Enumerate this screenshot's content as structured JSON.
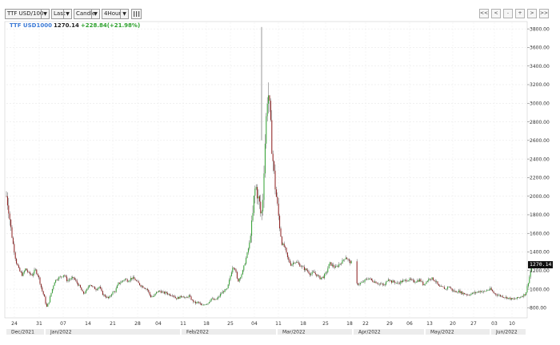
{
  "toolbar": {
    "symbol": "TTF USD/100",
    "price_type": "Last",
    "chart_style": "Candle",
    "interval": "4Hour",
    "dropdown_arrow": "▼",
    "indicators_icon": "bars-icon",
    "nav": [
      "<<",
      "<",
      "-",
      "+",
      ">",
      ">>"
    ]
  },
  "legend": {
    "symbol": "TTF USD1000",
    "last": "1270.14",
    "change": "+228.84(+21.98%)"
  },
  "last_price_tag": "1270.14",
  "colors": {
    "up": "#2ca02c",
    "down": "#8b1a1a",
    "legend_symbol": "#3d7bd6",
    "change": "#2ca02c"
  },
  "chart_data": {
    "type": "candlestick",
    "y_ticks": [
      800,
      1000,
      1200,
      1400,
      1600,
      1800,
      2000,
      2200,
      2400,
      2600,
      2800,
      3000,
      3200,
      3400,
      3600,
      3800
    ],
    "y_tick_labels": [
      "800.00",
      "1000.00",
      "1200.00",
      "1400.00",
      "1600.00",
      "1800.00",
      "2000.00",
      "2200.00",
      "2400.00",
      "2600.00",
      "2800.00",
      "3000.00",
      "3200.00",
      "3400.00",
      "3600.00",
      "3800.00"
    ],
    "ylim": [
      700,
      3870
    ],
    "x_ticks": [
      "24",
      "31",
      "07",
      "14",
      "21",
      "28",
      "04",
      "11",
      "18",
      "25",
      "04",
      "11",
      "18",
      "25",
      "18",
      "22",
      "29",
      "06",
      "13",
      "20",
      "27",
      "03",
      "10"
    ],
    "months": [
      "Dec/2021",
      "Jan/2022",
      "Feb/2022",
      "Mar/2022",
      "Apr/2022",
      "May/2022",
      "Jun/2022"
    ],
    "grid": true,
    "close_path": [
      [
        0,
        2000
      ],
      [
        3,
        1850
      ],
      [
        6,
        1620
      ],
      [
        9,
        1450
      ],
      [
        12,
        1300
      ],
      [
        16,
        1200
      ],
      [
        20,
        1150
      ],
      [
        24,
        1220
      ],
      [
        28,
        1170
      ],
      [
        32,
        1150
      ],
      [
        36,
        1210
      ],
      [
        40,
        1140
      ],
      [
        44,
        1000
      ],
      [
        48,
        900
      ],
      [
        50,
        800
      ],
      [
        53,
        860
      ],
      [
        56,
        960
      ],
      [
        60,
        1080
      ],
      [
        64,
        1120
      ],
      [
        68,
        1130
      ],
      [
        72,
        1160
      ],
      [
        76,
        1090
      ],
      [
        80,
        1110
      ],
      [
        84,
        1120
      ],
      [
        88,
        1070
      ],
      [
        92,
        1020
      ],
      [
        96,
        950
      ],
      [
        100,
        980
      ],
      [
        104,
        1060
      ],
      [
        108,
        1020
      ],
      [
        112,
        1000
      ],
      [
        116,
        1030
      ],
      [
        120,
        950
      ],
      [
        124,
        920
      ],
      [
        128,
        900
      ],
      [
        132,
        960
      ],
      [
        136,
        980
      ],
      [
        140,
        1060
      ],
      [
        144,
        1080
      ],
      [
        148,
        1110
      ],
      [
        152,
        1090
      ],
      [
        156,
        1120
      ],
      [
        160,
        1110
      ],
      [
        164,
        1070
      ],
      [
        168,
        1040
      ],
      [
        172,
        1020
      ],
      [
        176,
        1000
      ],
      [
        180,
        920
      ],
      [
        184,
        920
      ],
      [
        188,
        970
      ],
      [
        192,
        980
      ],
      [
        196,
        960
      ],
      [
        200,
        960
      ],
      [
        204,
        940
      ],
      [
        208,
        940
      ],
      [
        212,
        900
      ],
      [
        216,
        910
      ],
      [
        220,
        930
      ],
      [
        224,
        900
      ],
      [
        228,
        930
      ],
      [
        232,
        880
      ],
      [
        236,
        850
      ],
      [
        240,
        860
      ],
      [
        244,
        820
      ],
      [
        248,
        840
      ],
      [
        252,
        850
      ],
      [
        256,
        900
      ],
      [
        260,
        880
      ],
      [
        264,
        900
      ],
      [
        268,
        950
      ],
      [
        272,
        980
      ],
      [
        276,
        1000
      ],
      [
        280,
        1140
      ],
      [
        283,
        1250
      ],
      [
        286,
        1220
      ],
      [
        289,
        1080
      ],
      [
        292,
        1130
      ],
      [
        295,
        1180
      ],
      [
        298,
        1280
      ],
      [
        301,
        1380
      ],
      [
        304,
        1500
      ],
      [
        306,
        1650
      ],
      [
        308,
        1800
      ],
      [
        310,
        2050
      ],
      [
        312,
        2100
      ],
      [
        314,
        2000
      ],
      [
        316,
        1950
      ],
      [
        318,
        1800
      ],
      [
        320,
        1850
      ],
      [
        322,
        2300
      ],
      [
        324,
        2700
      ],
      [
        326,
        3050
      ],
      [
        328,
        3100
      ],
      [
        330,
        2800
      ],
      [
        332,
        2500
      ],
      [
        334,
        2300
      ],
      [
        336,
        2100
      ],
      [
        338,
        1950
      ],
      [
        340,
        1800
      ],
      [
        342,
        1650
      ],
      [
        344,
        1500
      ],
      [
        346,
        1470
      ],
      [
        348,
        1450
      ],
      [
        350,
        1380
      ],
      [
        352,
        1320
      ],
      [
        356,
        1260
      ],
      [
        360,
        1300
      ],
      [
        364,
        1280
      ],
      [
        368,
        1250
      ],
      [
        372,
        1220
      ],
      [
        376,
        1200
      ],
      [
        380,
        1160
      ],
      [
        384,
        1180
      ],
      [
        388,
        1150
      ],
      [
        392,
        1120
      ],
      [
        396,
        1130
      ],
      [
        400,
        1180
      ],
      [
        404,
        1280
      ],
      [
        408,
        1250
      ],
      [
        412,
        1230
      ],
      [
        416,
        1270
      ],
      [
        420,
        1300
      ],
      [
        424,
        1350
      ],
      [
        428,
        1300
      ],
      [
        432,
        1280
      ],
      [
        437,
        1050
      ],
      [
        441,
        1060
      ],
      [
        445,
        1070
      ],
      [
        449,
        1100
      ],
      [
        453,
        1120
      ],
      [
        457,
        1090
      ],
      [
        461,
        1080
      ],
      [
        465,
        1060
      ],
      [
        469,
        1050
      ],
      [
        473,
        1040
      ],
      [
        477,
        1120
      ],
      [
        481,
        1080
      ],
      [
        485,
        1080
      ],
      [
        489,
        1060
      ],
      [
        493,
        1080
      ],
      [
        497,
        1090
      ],
      [
        501,
        1100
      ],
      [
        505,
        1100
      ],
      [
        509,
        1080
      ],
      [
        513,
        1090
      ],
      [
        517,
        1100
      ],
      [
        521,
        1050
      ],
      [
        525,
        1080
      ],
      [
        529,
        1120
      ],
      [
        533,
        1110
      ],
      [
        537,
        1080
      ],
      [
        541,
        1020
      ],
      [
        545,
        1020
      ],
      [
        549,
        1000
      ],
      [
        553,
        1030
      ],
      [
        557,
        990
      ],
      [
        561,
        970
      ],
      [
        565,
        980
      ],
      [
        569,
        960
      ],
      [
        573,
        950
      ],
      [
        577,
        940
      ],
      [
        581,
        950
      ],
      [
        585,
        960
      ],
      [
        589,
        970
      ],
      [
        593,
        980
      ],
      [
        597,
        970
      ],
      [
        601,
        990
      ],
      [
        605,
        1000
      ],
      [
        609,
        960
      ],
      [
        613,
        940
      ],
      [
        617,
        930
      ],
      [
        621,
        920
      ],
      [
        625,
        910
      ],
      [
        629,
        900
      ],
      [
        633,
        890
      ],
      [
        637,
        900
      ],
      [
        641,
        910
      ],
      [
        645,
        930
      ],
      [
        649,
        950
      ],
      [
        653,
        1100
      ],
      [
        657,
        1270
      ]
    ]
  }
}
